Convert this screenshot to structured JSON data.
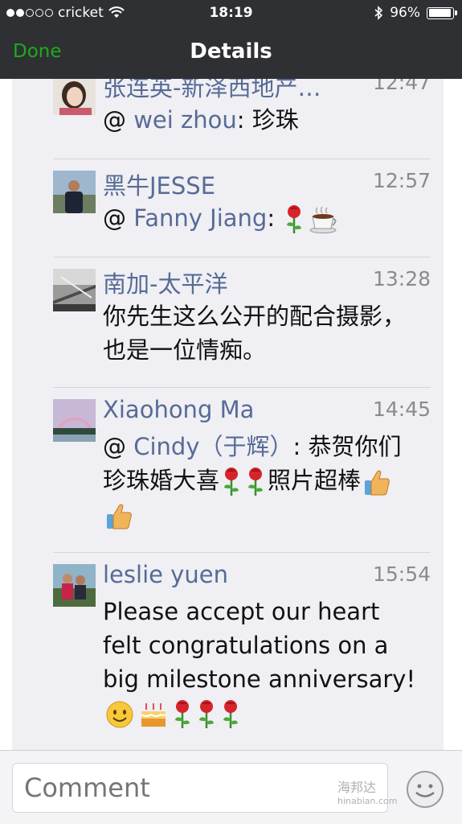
{
  "status_bar": {
    "carrier": "cricket",
    "time": "18:19",
    "battery": "96%",
    "battery_level": 0.96,
    "signal_strength": 2,
    "signal_max": 5
  },
  "nav": {
    "done_label": "Done",
    "title": "Details"
  },
  "comments": [
    {
      "name": "张连英-新泽西地产…",
      "time": "12:47",
      "mention": "wei zhou",
      "text": ": 珍珠"
    },
    {
      "name": "黑牛JESSE",
      "time": "12:57",
      "mention": "Fanny Jiang",
      "text": ": "
    },
    {
      "name": "南加-太平洋",
      "time": "13:28",
      "text": "你先生这么公开的配合摄影，也是一位情痴。"
    },
    {
      "name": "Xiaohong Ma",
      "time": "14:45",
      "mention": "Cindy（于辉）",
      "text": ": 恭贺你们珍珠婚大喜",
      "text2": "照片超棒"
    },
    {
      "name": "leslie yuen",
      "time": "15:54",
      "text": "Please accept our heart felt congratulations on a big milestone anniversary!"
    }
  ],
  "input": {
    "placeholder": "Comment"
  },
  "watermark": {
    "text": "海邦达",
    "sub": "hinabian.com"
  },
  "colors": {
    "nav_bg": "#2f3033",
    "done_green": "#1aad19",
    "name_blue": "#576b95",
    "panel_bg": "#efeff4"
  }
}
